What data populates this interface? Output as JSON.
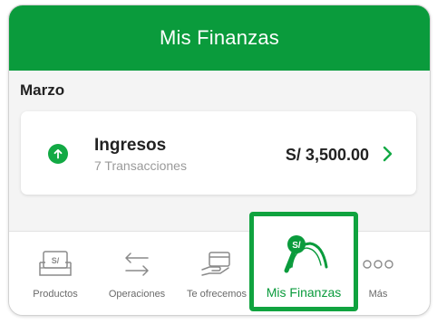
{
  "header": {
    "title": "Mis Finanzas"
  },
  "summary": {
    "month": "Marzo"
  },
  "income_card": {
    "title": "Ingresos",
    "transactions": "7 Transacciones",
    "amount": "S/ 3,500.00",
    "icon": "arrow-up-icon"
  },
  "tabbar": {
    "items": [
      {
        "label": "Productos",
        "icon": "products-icon"
      },
      {
        "label": "Operaciones",
        "icon": "transfer-arrows-icon"
      },
      {
        "label": "Te ofrecemos",
        "icon": "offers-card-hand-icon"
      },
      {
        "label": "Mis Finanzas",
        "icon": "finances-gauge-icon",
        "selected": true
      },
      {
        "label": "Más",
        "icon": "more-dots-icon"
      }
    ]
  },
  "colors": {
    "brand_green": "#0a9b3c",
    "highlight_border": "#10a33f"
  }
}
